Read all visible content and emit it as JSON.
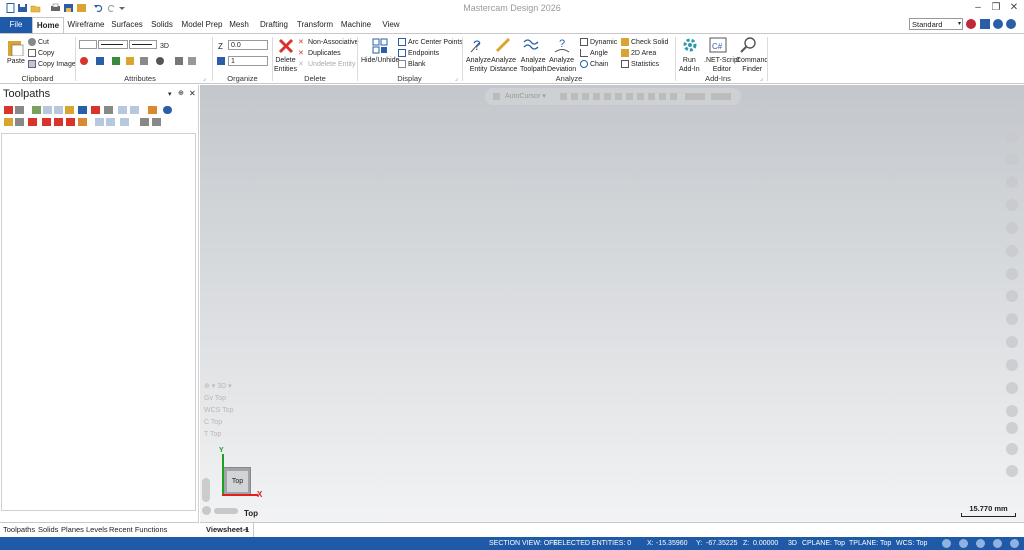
{
  "window": {
    "title": "Mastercam Design 2026"
  },
  "tabs": [
    "File",
    "Home",
    "Wireframe",
    "Surfaces",
    "Solids",
    "Model Prep",
    "Mesh",
    "Drafting",
    "Transform",
    "Machine",
    "View"
  ],
  "active_tab": "Home",
  "config_select": "Standard",
  "ribbon": {
    "clipboard": {
      "label": "Clipboard",
      "paste": "Paste",
      "cut": "Cut",
      "copy": "Copy",
      "copy_image": "Copy Image"
    },
    "attributes": {
      "label": "Attributes",
      "mode_3d": "3D"
    },
    "organize": {
      "label": "Organize",
      "z_label": "Z",
      "z_value": "0.0",
      "level_value": "1"
    },
    "delete": {
      "label": "Delete",
      "delete_entities": "Delete\nEntities",
      "non_associative": "Non-Associative",
      "duplicates": "Duplicates",
      "undelete_entity": "Undelete Entity"
    },
    "display": {
      "label": "Display",
      "hide_unhide": "Hide/Unhide",
      "arc_center_points": "Arc Center Points",
      "endpoints": "Endpoints",
      "blank": "Blank"
    },
    "analyze": {
      "label": "Analyze",
      "analyze_entity": "Analyze\nEntity",
      "analyze_distance": "Analyze\nDistance",
      "analyze_toolpath": "Analyze\nToolpath",
      "analyze_deviation": "Analyze\nDeviation",
      "dynamic": "Dynamic",
      "angle": "Angle",
      "chain": "Chain",
      "check_solid": "Check Solid",
      "area_2d": "2D Area",
      "statistics": "Statistics"
    },
    "addins": {
      "label": "Add-Ins",
      "run_addin": "Run\nAdd-In",
      "net_script": ".NET-Script\nEditor",
      "command_finder": "Command\nFinder"
    }
  },
  "panel": {
    "title": "Toolpaths",
    "bottom_tabs": [
      "Toolpaths",
      "Solids",
      "Planes",
      "Levels",
      "Recent Functions"
    ]
  },
  "viewport": {
    "autocursor": "AutoCursor",
    "view_selector": {
      "mode": "3D",
      "gview": "Top",
      "wcs": "Top",
      "cplane": "Top",
      "tplane": "Top",
      "gv_label": "Gv",
      "wcs_label": "WCS",
      "c_label": "C",
      "t_label": "T"
    },
    "cube_label": "Top",
    "view_name": "Top",
    "axis_x": "X",
    "axis_y": "Y",
    "scale": "15.770 mm"
  },
  "sheet_tab": "Viewsheet-1",
  "sheet_add": "+",
  "status": {
    "section_view": "SECTION VIEW: OFF",
    "selected": "SELECTED ENTITIES: 0",
    "x_label": "X:",
    "x": "-15.35960",
    "y_label": "Y:",
    "y": "-67.35225",
    "z_label": "Z:",
    "z": "0.00000",
    "mode": "3D",
    "cplane": "CPLANE: Top",
    "tplane": "TPLANE: Top",
    "wcs": "WCS: Top"
  },
  "colors": {
    "accent": "#1f5aa8",
    "delete_red": "#d9342b",
    "axis_x": "#e02020",
    "axis_y": "#20a020"
  }
}
